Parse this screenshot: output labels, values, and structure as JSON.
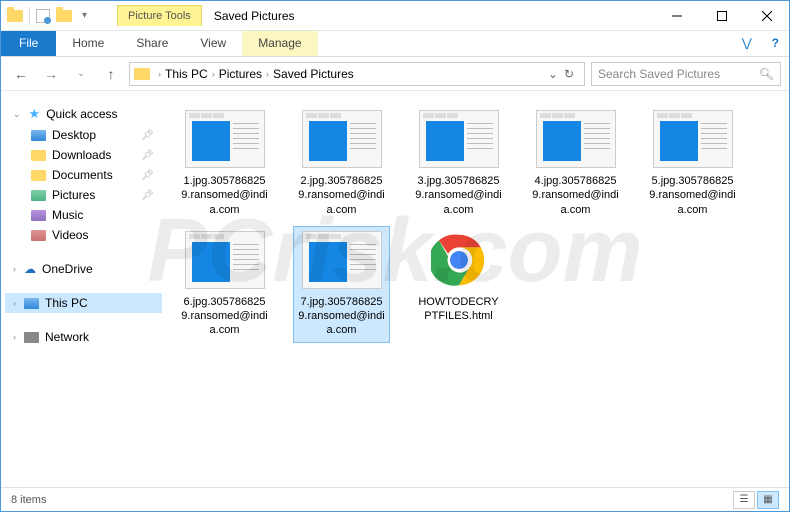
{
  "window": {
    "picture_tools_label": "Picture Tools",
    "title": "Saved Pictures"
  },
  "ribbon": {
    "file": "File",
    "home": "Home",
    "share": "Share",
    "view": "View",
    "manage": "Manage"
  },
  "breadcrumb": {
    "items": [
      "This PC",
      "Pictures",
      "Saved Pictures"
    ]
  },
  "search": {
    "placeholder": "Search Saved Pictures"
  },
  "sidebar": {
    "quick_access": "Quick access",
    "items": [
      {
        "label": "Desktop"
      },
      {
        "label": "Downloads"
      },
      {
        "label": "Documents"
      },
      {
        "label": "Pictures"
      },
      {
        "label": "Music"
      },
      {
        "label": "Videos"
      }
    ],
    "onedrive": "OneDrive",
    "this_pc": "This PC",
    "network": "Network"
  },
  "files": [
    {
      "name": "1.jpg.3057868259.ransomed@india.com",
      "type": "image"
    },
    {
      "name": "2.jpg.3057868259.ransomed@india.com",
      "type": "image"
    },
    {
      "name": "3.jpg.3057868259.ransomed@india.com",
      "type": "image"
    },
    {
      "name": "4.jpg.3057868259.ransomed@india.com",
      "type": "image"
    },
    {
      "name": "5.jpg.3057868259.ransomed@india.com",
      "type": "image"
    },
    {
      "name": "6.jpg.3057868259.ransomed@india.com",
      "type": "image"
    },
    {
      "name": "7.jpg.3057868259.ransomed@india.com",
      "type": "image",
      "selected": true
    },
    {
      "name": "HOWTODECRYPTFILES.html",
      "type": "html"
    }
  ],
  "status": {
    "count_label": "8 items"
  },
  "watermark": "PCrisk.com"
}
